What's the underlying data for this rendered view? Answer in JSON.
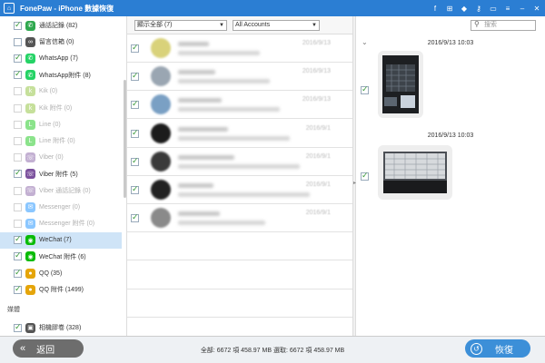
{
  "titlebar": {
    "app_name": "FonePaw",
    "separator": " - ",
    "window_title": "iPhone 數據恢復",
    "logo_icon": "house-icon",
    "icons": [
      "facebook-icon",
      "gift-icon",
      "diamond-icon",
      "key-icon",
      "chat-icon",
      "menu-icon",
      "minimize-icon",
      "close-icon"
    ]
  },
  "sidebar": {
    "items": [
      {
        "label": "通話記錄 (82)",
        "checked": true,
        "enabled": true,
        "icon": "phone-icon",
        "color": "#2fa84f"
      },
      {
        "label": "留言信箱 (0)",
        "checked": false,
        "enabled": true,
        "icon": "voicemail-icon",
        "color": "#555555"
      },
      {
        "label": "WhatsApp (7)",
        "checked": true,
        "enabled": true,
        "icon": "whatsapp-icon",
        "color": "#25d366"
      },
      {
        "label": "WhatsApp附件 (8)",
        "checked": true,
        "enabled": true,
        "icon": "whatsapp-icon",
        "color": "#25d366"
      },
      {
        "label": "Kik (0)",
        "checked": false,
        "enabled": false,
        "icon": "kik-icon",
        "color": "#82bc23"
      },
      {
        "label": "Kik 附件 (0)",
        "checked": false,
        "enabled": false,
        "icon": "kik-icon",
        "color": "#82bc23"
      },
      {
        "label": "Line (0)",
        "checked": false,
        "enabled": false,
        "icon": "line-icon",
        "color": "#00c300"
      },
      {
        "label": "Line 附件 (0)",
        "checked": false,
        "enabled": false,
        "icon": "line-icon",
        "color": "#00c300"
      },
      {
        "label": "Viber (0)",
        "checked": false,
        "enabled": false,
        "icon": "viber-icon",
        "color": "#7b519d"
      },
      {
        "label": "Viber 附件 (5)",
        "checked": true,
        "enabled": true,
        "icon": "viber-icon",
        "color": "#7b519d"
      },
      {
        "label": "Viber 通話記錄 (0)",
        "checked": false,
        "enabled": false,
        "icon": "viber-icon",
        "color": "#7b519d"
      },
      {
        "label": "Messenger (0)",
        "checked": false,
        "enabled": false,
        "icon": "messenger-icon",
        "color": "#0084ff"
      },
      {
        "label": "Messenger 附件 (0)",
        "checked": false,
        "enabled": false,
        "icon": "messenger-icon",
        "color": "#0084ff"
      },
      {
        "label": "WeChat (7)",
        "checked": true,
        "enabled": true,
        "selected": true,
        "icon": "wechat-icon",
        "color": "#09bb07"
      },
      {
        "label": "WeChat 附件 (6)",
        "checked": true,
        "enabled": true,
        "icon": "wechat-icon",
        "color": "#09bb07"
      },
      {
        "label": "QQ (35)",
        "checked": true,
        "enabled": true,
        "icon": "qq-icon",
        "color": "#e5a50a"
      },
      {
        "label": "QQ 附件 (1499)",
        "checked": true,
        "enabled": true,
        "icon": "qq-icon",
        "color": "#e5a50a"
      }
    ],
    "section_media": "媒體",
    "media_items": [
      {
        "label": "相機膠卷 (328)",
        "checked": true,
        "enabled": true,
        "icon": "camera-icon",
        "color": "#555555"
      }
    ]
  },
  "filter": {
    "show_all": "顯示全部 (7)",
    "accounts": "All Accounts"
  },
  "message_rows": [
    {
      "name": "",
      "date": "2016/9/13",
      "avatar_color": "#d9d27a"
    },
    {
      "name": "",
      "date": "2016/9/13",
      "avatar_color": "#9aa6b2"
    },
    {
      "name": "",
      "date": "2016/9/13",
      "avatar_color": "#7aa0c4"
    },
    {
      "name": "",
      "date": "2016/9/1",
      "avatar_color": "#1c1c1c"
    },
    {
      "name": "",
      "date": "2016/9/1",
      "avatar_color": "#3a3a3a"
    },
    {
      "name": "",
      "date": "2016/9/1",
      "avatar_color": "#222222"
    },
    {
      "name": "",
      "date": "2016/9/1",
      "avatar_color": "#8a8a8a"
    }
  ],
  "search": {
    "placeholder": "搜索"
  },
  "preview": {
    "messages": [
      {
        "timestamp": "2016/9/13 10:03",
        "kind": "photo-keyboard-dark"
      },
      {
        "timestamp": "2016/9/13 10:03",
        "kind": "photo-keyboard-light"
      }
    ]
  },
  "footer": {
    "back_label": "返回",
    "status": "全部: 6672 項 458.97 MB 選取: 6672 項 458.97 MB",
    "recover_label": "恢復",
    "colors": {
      "back": "#6d6d6d",
      "recover": "#3c8fd8"
    }
  }
}
